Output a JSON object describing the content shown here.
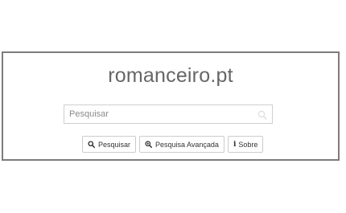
{
  "site": {
    "title": "romanceiro.pt"
  },
  "search": {
    "placeholder": "Pesquisar",
    "value": "",
    "icon": "search-icon"
  },
  "buttons": {
    "search_label": "Pesquisar",
    "advanced_label": "Pesquisa Avançada",
    "about_label": "Sobre",
    "search_icon": "search-icon",
    "advanced_icon": "zoom-in-icon",
    "about_icon": "info-icon"
  },
  "colors": {
    "frame_border": "#7c7c7c",
    "title_text": "#666666",
    "button_border": "#cccccc"
  }
}
